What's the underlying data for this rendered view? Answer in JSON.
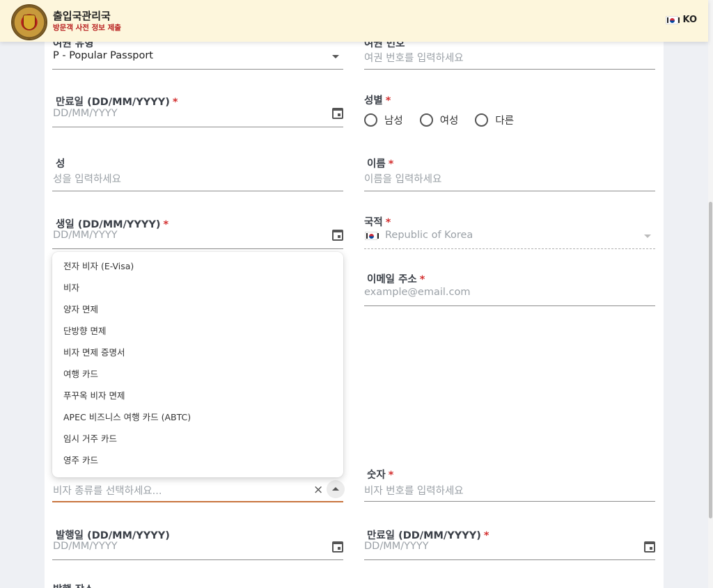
{
  "header": {
    "title": "출입국관리국",
    "subtitle": "방문객 사전 정보 제출",
    "lang_code": "KO"
  },
  "form": {
    "passport_type": {
      "label": "여권 유형",
      "value": "P - Popular Passport"
    },
    "passport_number": {
      "label": "여권 번호",
      "placeholder": "여권 번호를 입력하세요"
    },
    "expiry_date": {
      "label": "만료일 (DD/MM/YYYY)",
      "placeholder": "DD/MM/YYYY"
    },
    "gender": {
      "label": "성별",
      "options": [
        "남성",
        "여성",
        "다른"
      ]
    },
    "last_name": {
      "label": "성",
      "placeholder": "성을 입력하세요"
    },
    "first_name": {
      "label": "이름",
      "placeholder": "이름을 입력하세요"
    },
    "birth_date": {
      "label": "생일 (DD/MM/YYYY)",
      "placeholder": "DD/MM/YYYY"
    },
    "nationality": {
      "label": "국적",
      "value": "Republic of Korea"
    },
    "email": {
      "label": "이메일 주소",
      "placeholder": "example@email.com"
    },
    "visa_type": {
      "placeholder": "비자 종류를 선택하세요..."
    },
    "visa_number": {
      "label": "숫자",
      "placeholder": "비자 번호를 입력하세요"
    },
    "issue_date": {
      "label": "발행일 (DD/MM/YYYY)",
      "placeholder": "DD/MM/YYYY"
    },
    "visa_expiry": {
      "label": "만료일 (DD/MM/YYYY)",
      "placeholder": "DD/MM/YYYY"
    },
    "issue_place": {
      "label": "발행 장소"
    },
    "required_mark": "*"
  },
  "visa_dropdown": {
    "items": [
      "전자 비자 (E-Visa)",
      "비자",
      "양자 면제",
      "단방향 면제",
      "비자 면제 증명서",
      "여행 카드",
      "푸꾸옥 비자 면제",
      "APEC 비즈니스 여행 카드 (ABTC)",
      "임시 거주 카드",
      "영주 카드"
    ]
  },
  "icons": {
    "clear": "×",
    "calendar": "calendar-icon",
    "flag": "kr-flag-icon"
  },
  "colors": {
    "header_bg": "#fdf6dc",
    "subtitle": "#b71c1c",
    "required": "#d32f2f",
    "active_underline": "#c8733d"
  }
}
